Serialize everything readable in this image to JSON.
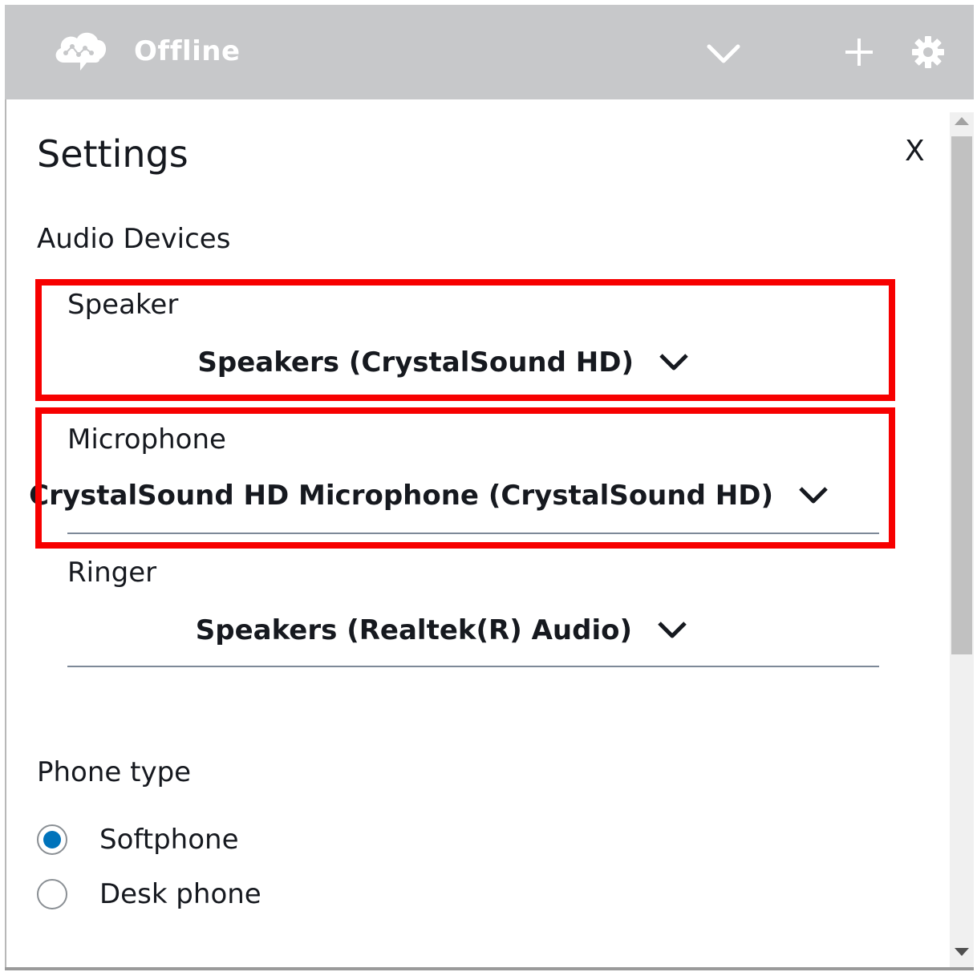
{
  "topbar": {
    "status_label": "Offline"
  },
  "settings": {
    "title": "Settings",
    "close_label": "X",
    "audio_devices": {
      "heading": "Audio Devices",
      "speaker": {
        "label": "Speaker",
        "value": "Speakers (CrystalSound HD)"
      },
      "microphone": {
        "label": "Microphone",
        "value": "CrystalSound HD Microphone (CrystalSound HD)"
      },
      "ringer": {
        "label": "Ringer",
        "value": "Speakers (Realtek(R) Audio)"
      }
    },
    "phone_type": {
      "heading": "Phone type",
      "options": [
        {
          "label": "Softphone",
          "selected": true
        },
        {
          "label": "Desk phone",
          "selected": false
        }
      ]
    }
  },
  "icons": {
    "status_icon": "cloud-network-icon",
    "status_dropdown": "chevron-down-icon",
    "add": "plus-icon",
    "settings": "gear-icon"
  },
  "colors": {
    "topbar_bg": "#c7c8ca",
    "highlight": "#f70000",
    "radio_selected": "#0073bb"
  }
}
